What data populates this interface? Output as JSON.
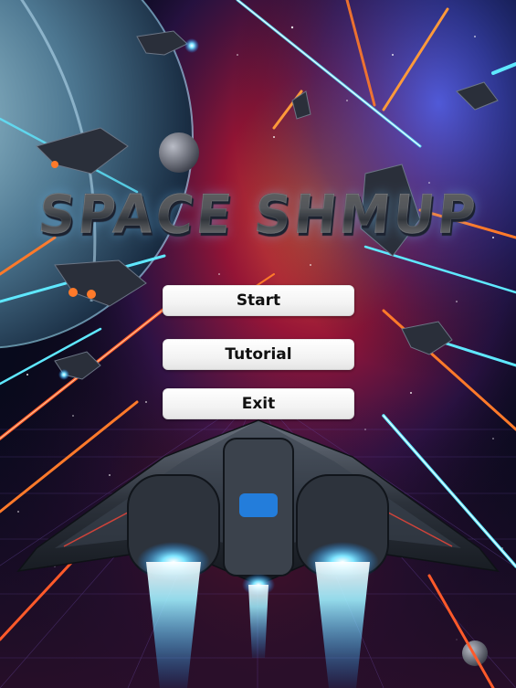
{
  "game": {
    "title": "SPACE SHMUP"
  },
  "menu": {
    "start_label": "Start",
    "tutorial_label": "Tutorial",
    "exit_label": "Exit"
  },
  "colors": {
    "nebula_red": "#c8202f",
    "nebula_blue": "#1a3f9a",
    "laser_cyan": "#5fe8ff",
    "laser_orange": "#ff7a2a",
    "engine_glow": "#7fe6ff",
    "button_bg": "#f2f2f2",
    "button_text": "#111111"
  }
}
